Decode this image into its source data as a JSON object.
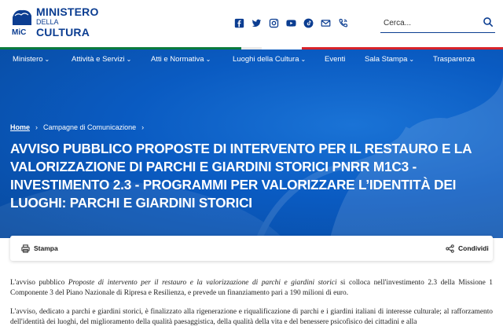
{
  "header": {
    "logo": {
      "line1": "MINISTERO",
      "line2": "DELLA",
      "line3": "CULTURA",
      "mark_text": "MiC"
    },
    "social": [
      {
        "name": "facebook-icon"
      },
      {
        "name": "twitter-icon"
      },
      {
        "name": "instagram-icon"
      },
      {
        "name": "youtube-icon"
      },
      {
        "name": "tiktok-icon"
      },
      {
        "name": "mail-icon"
      },
      {
        "name": "phone-icon"
      }
    ],
    "search": {
      "placeholder": "Cerca..."
    }
  },
  "nav": {
    "items": [
      {
        "label": "Ministero",
        "has_menu": true
      },
      {
        "label": "Attività e Servizi",
        "has_menu": true
      },
      {
        "label": "Atti e Normativa",
        "has_menu": true
      },
      {
        "label": "Luoghi della Cultura",
        "has_menu": true
      },
      {
        "label": "Eventi",
        "has_menu": false
      },
      {
        "label": "Sala Stampa",
        "has_menu": true
      },
      {
        "label": "Trasparenza",
        "has_menu": false
      }
    ]
  },
  "breadcrumb": {
    "home": "Home",
    "current": "Campagne di Comunicazione"
  },
  "page": {
    "title": "AVVISO PUBBLICO PROPOSTE DI INTERVENTO PER IL RESTAURO E LA VALORIZZAZIONE DI PARCHI E GIARDINI STORICI PNRR M1C3 - INVESTIMENTO 2.3 - PROGRAMMI PER VALORIZZARE L’IDENTITÀ DEI LUOGHI: PARCHI E GIARDINI STORICI"
  },
  "toolbar": {
    "print_label": "Stampa",
    "share_label": "Condividi"
  },
  "content": {
    "p1_prefix": "L'avviso pubblico ",
    "p1_italic": "Proposte di intervento per il restauro e la valorizzazione di parchi e giardini storici",
    "p1_suffix": " si colloca nell'investimento 2.3 della Missione 1 Componente 3 del Piano Nazionale di Ripresa e Resilienza, e prevede un finanziamento pari a 190 milioni di euro.",
    "p2": "L'avviso, dedicato a parchi e giardini storici, è finalizzato alla rigenerazione e riqualificazione di parchi e i giardini italiani di interesse culturale; al rafforzamento dell'identità dei luoghi, del miglioramento della qualità paesaggistica, della qualità della vita e del benessere psicofisico dei cittadini e alla"
  },
  "colors": {
    "brand_blue": "#0b3d91",
    "hero_blue": "#0a5bc2"
  }
}
